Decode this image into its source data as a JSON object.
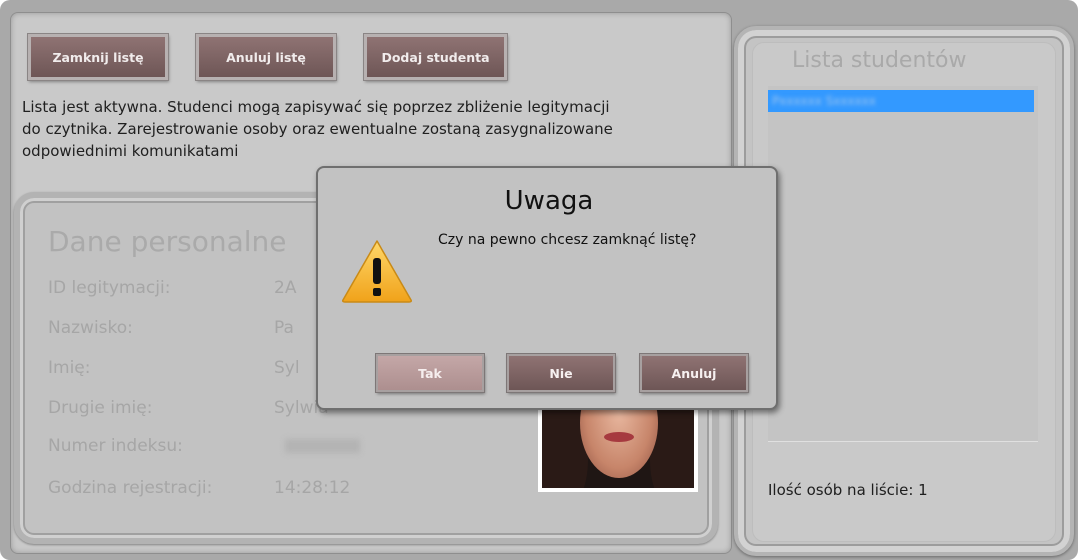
{
  "toolbar": {
    "close_list": "Zamknij listę",
    "cancel_list": "Anuluj listę",
    "add_student": "Dodaj studenta"
  },
  "info": {
    "line1": "Lista jest aktywna. Studenci mogą zapisywać się poprzez zbliżenie legitymacji",
    "line2": "do czytnika. Zarejestrowanie osoby oraz ewentualne zostaną zasygnalizowane",
    "line3": "odpowiednimi komunikatami"
  },
  "personal": {
    "title": "Dane personalne",
    "fields": [
      {
        "label": "ID legitymacji:",
        "value": "2A"
      },
      {
        "label": "Nazwisko:",
        "value": "Pa"
      },
      {
        "label": "Imię:",
        "value": "Syl"
      },
      {
        "label": "Drugie imię:",
        "value": "Sylwia"
      },
      {
        "label": "Numer indeksu:",
        "value": ""
      },
      {
        "label": "Godzina rejestracji:",
        "value": "14:28:12"
      }
    ]
  },
  "students": {
    "title": "Lista studentów",
    "selected_item": "Pxxxxxx Sxxxxxx",
    "count_label": "Ilość osób na liście: 1"
  },
  "dialog": {
    "title": "Uwaga",
    "message": "Czy na pewno chcesz zamknąć listę?",
    "icon": "warning-icon",
    "yes": "Tak",
    "no": "Nie",
    "cancel": "Anuluj"
  },
  "colors": {
    "button": "#7c6363",
    "button_pressed": "#b89b9b",
    "selection": "#3399ff",
    "background": "#c9c9c9"
  }
}
